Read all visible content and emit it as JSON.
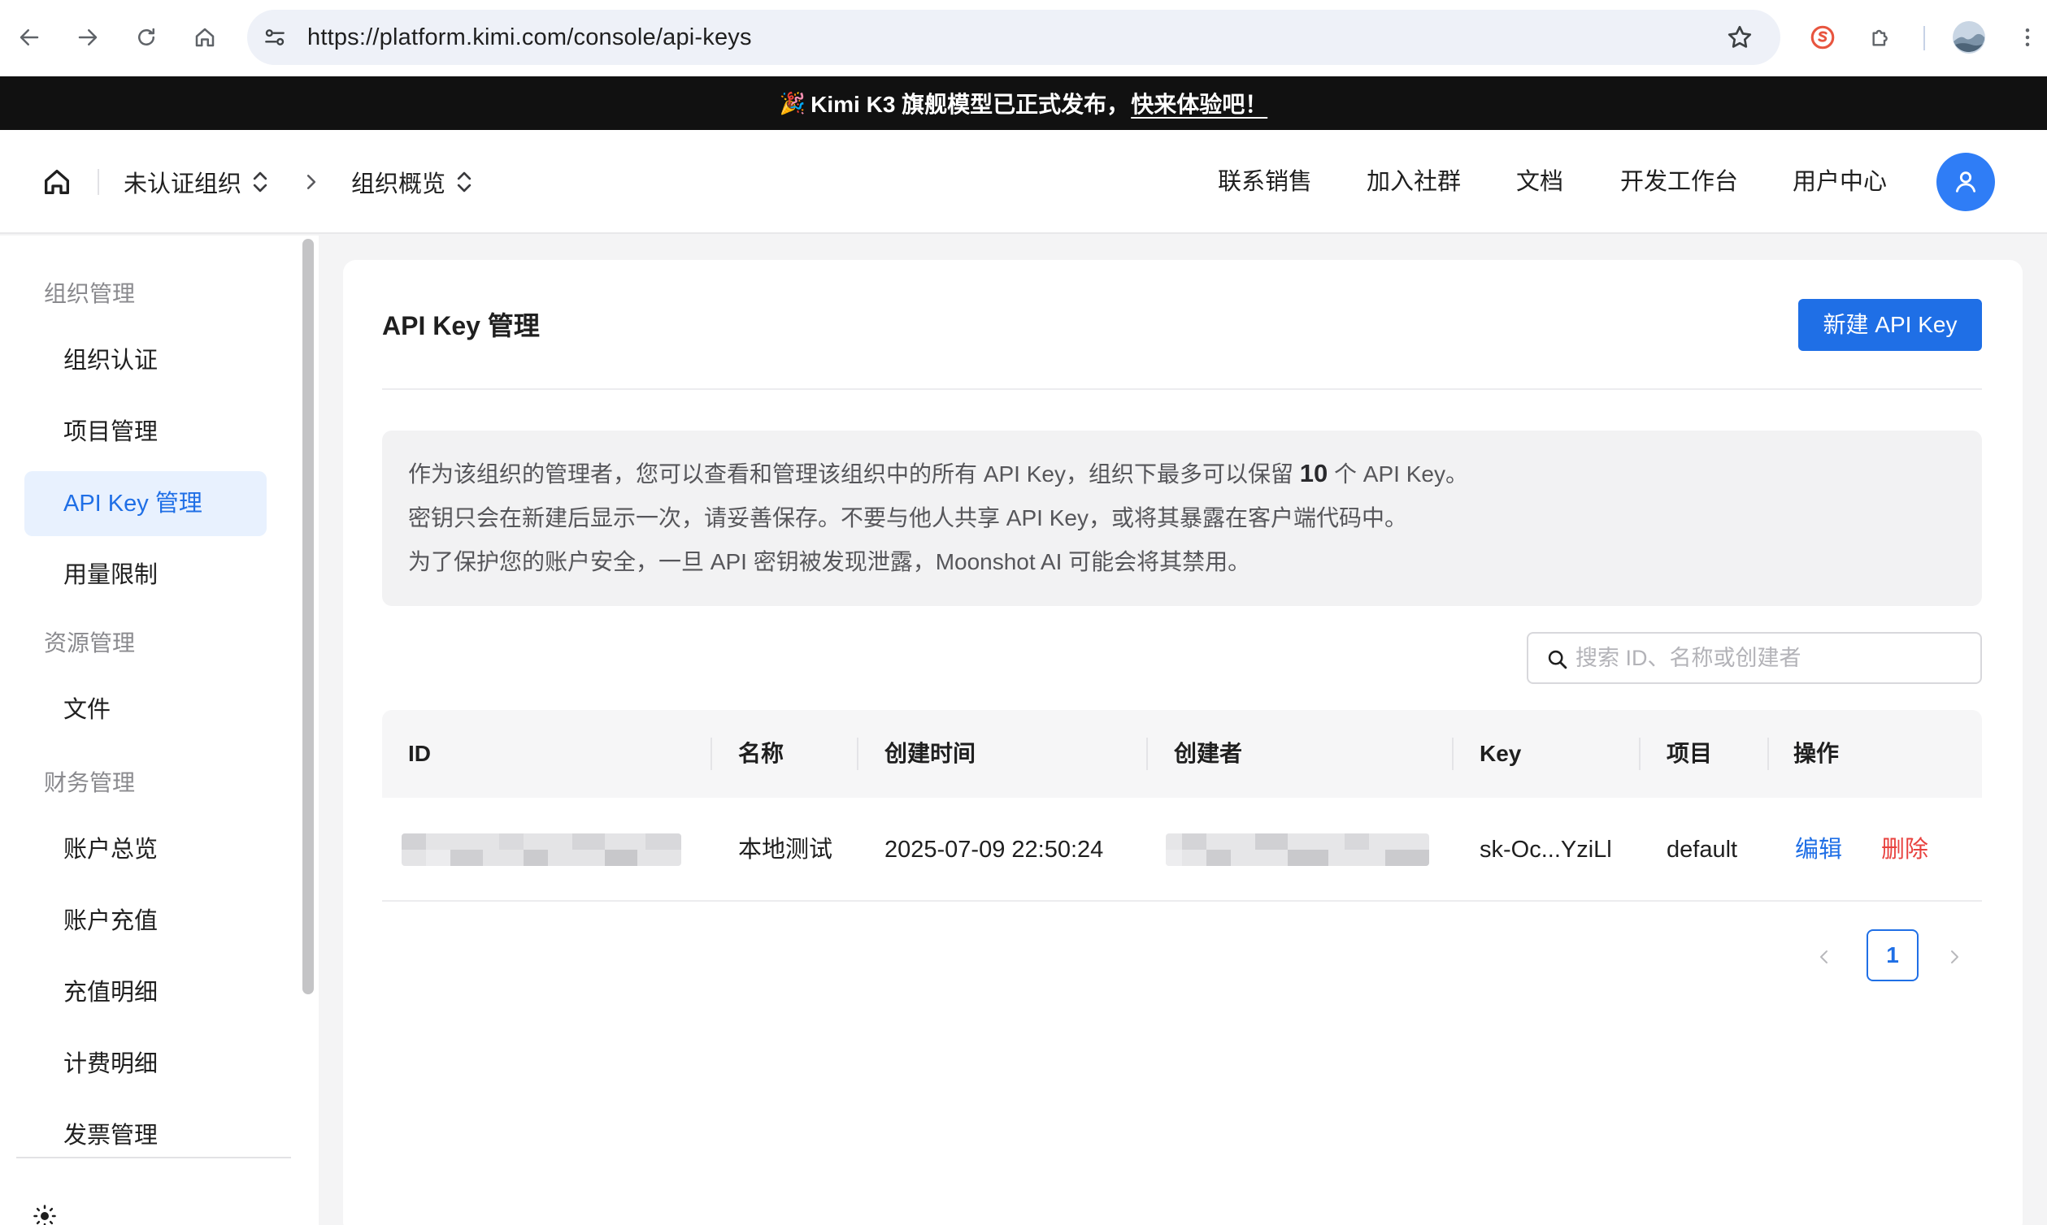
{
  "browser": {
    "url": "https://platform.kimi.com/console/api-keys"
  },
  "banner": {
    "text": "Kimi K3 旗舰模型已正式发布，",
    "cta": "快来体验吧！"
  },
  "header": {
    "org": "未认证组织",
    "section": "组织概览",
    "nav": [
      "联系销售",
      "加入社群",
      "文档",
      "开发工作台",
      "用户中心"
    ]
  },
  "sidebar": {
    "groups": [
      {
        "label": "组织管理",
        "items": [
          "组织认证",
          "项目管理",
          "API Key 管理",
          "用量限制"
        ]
      },
      {
        "label": "资源管理",
        "items": [
          "文件"
        ]
      },
      {
        "label": "财务管理",
        "items": [
          "账户总览",
          "账户充值",
          "充值明细",
          "计费明细",
          "发票管理"
        ]
      }
    ],
    "active": "API Key 管理"
  },
  "page": {
    "title": "API Key 管理",
    "create_button": "新建 API Key",
    "notice": {
      "line1_pre": "作为该组织的管理者，您可以查看和管理该组织中的所有 API Key，组织下最多可以保留",
      "line1_num": "10",
      "line1_post": "个 API Key。",
      "line2": "密钥只会在新建后显示一次，请妥善保存。不要与他人共享 API Key，或将其暴露在客户端代码中。",
      "line3": "为了保护您的账户安全，一旦 API 密钥被发现泄露，Moonshot AI 可能会将其禁用。"
    },
    "search_placeholder": "搜索 ID、名称或创建者",
    "table": {
      "columns": [
        "ID",
        "名称",
        "创建时间",
        "创建者",
        "Key",
        "项目",
        "操作"
      ],
      "rows": [
        {
          "name": "本地测试",
          "created_at": "2025-07-09 22:50:24",
          "key": "sk-Oc...YziLl",
          "project": "default",
          "edit": "编辑",
          "delete": "删除"
        }
      ]
    },
    "pagination": {
      "current": "1"
    }
  },
  "colors": {
    "accent": "#1f6fe6",
    "danger": "#e8423f",
    "banner_bg": "#111111"
  }
}
